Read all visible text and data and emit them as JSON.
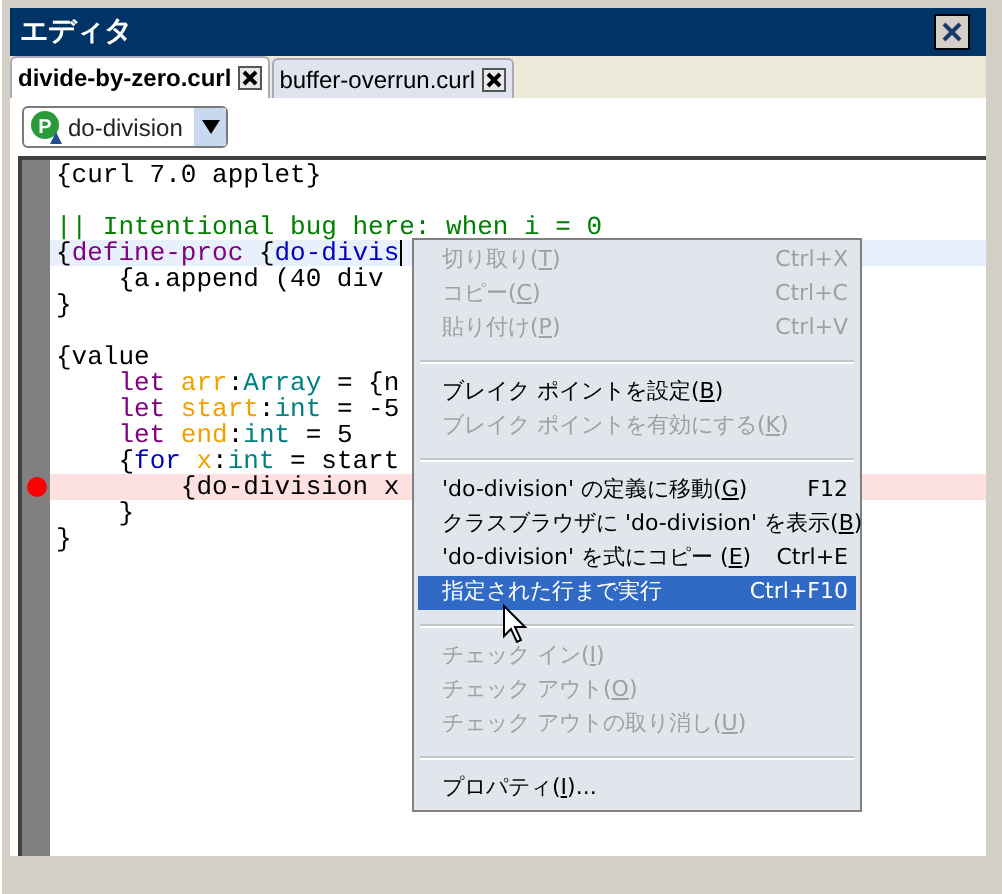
{
  "window": {
    "title": "エディタ"
  },
  "tabs": [
    {
      "label": "divide-by-zero.curl",
      "selected": true
    },
    {
      "label": "buffer-overrun.curl",
      "selected": false
    }
  ],
  "procedure_dropdown": {
    "icon_letter": "P",
    "value": "do-division"
  },
  "code_lines": [
    {
      "current": false,
      "breakpoint": false,
      "segments": [
        {
          "kind": "plain",
          "text": "{curl 7.0 applet}"
        }
      ]
    },
    {
      "current": false,
      "breakpoint": false
    },
    {
      "current": false,
      "breakpoint": false,
      "segments": [
        {
          "kind": "comment",
          "text": "|| Intentional bug here: when i = 0"
        }
      ]
    },
    {
      "current": true,
      "breakpoint": false,
      "segments": [
        {
          "kind": "plain",
          "text": "{"
        },
        {
          "kind": "keyword",
          "text": "define-proc"
        },
        {
          "kind": "plain",
          "text": " {"
        },
        {
          "kind": "name",
          "text": "do-divis"
        }
      ]
    },
    {
      "current": false,
      "breakpoint": false,
      "segments": [
        {
          "kind": "plain",
          "text": "    {a.append (40 div"
        }
      ]
    },
    {
      "current": false,
      "breakpoint": false,
      "segments": [
        {
          "kind": "plain",
          "text": "}"
        }
      ]
    },
    {
      "current": false,
      "breakpoint": false
    },
    {
      "current": false,
      "breakpoint": false,
      "segments": [
        {
          "kind": "plain",
          "text": "{value"
        }
      ]
    },
    {
      "current": false,
      "breakpoint": false,
      "segments": [
        {
          "kind": "keyword",
          "text": "    let"
        },
        {
          "kind": "variable",
          "text": " arr"
        },
        {
          "kind": "plain",
          "text": ":"
        },
        {
          "kind": "type",
          "text": "Array"
        },
        {
          "kind": "plain",
          "text": " = {n"
        }
      ]
    },
    {
      "current": false,
      "breakpoint": false,
      "segments": [
        {
          "kind": "keyword",
          "text": "    let"
        },
        {
          "kind": "variable",
          "text": " start"
        },
        {
          "kind": "plain",
          "text": ":"
        },
        {
          "kind": "type",
          "text": "int"
        },
        {
          "kind": "plain",
          "text": " = -5"
        }
      ]
    },
    {
      "current": false,
      "breakpoint": false,
      "segments": [
        {
          "kind": "keyword",
          "text": "    let"
        },
        {
          "kind": "variable",
          "text": " end"
        },
        {
          "kind": "plain",
          "text": ":"
        },
        {
          "kind": "type",
          "text": "int"
        },
        {
          "kind": "plain",
          "text": " = 5"
        }
      ]
    },
    {
      "current": false,
      "breakpoint": false,
      "segments": [
        {
          "kind": "plain",
          "text": "    {"
        },
        {
          "kind": "name",
          "text": "for"
        },
        {
          "kind": "variable",
          "text": " x"
        },
        {
          "kind": "plain",
          "text": ":"
        },
        {
          "kind": "type",
          "text": "int"
        },
        {
          "kind": "plain",
          "text": " = start"
        }
      ]
    },
    {
      "current": false,
      "breakpoint": true,
      "segments": [
        {
          "kind": "plain",
          "text": "        {do-division x"
        }
      ]
    },
    {
      "current": false,
      "breakpoint": false,
      "segments": [
        {
          "kind": "plain",
          "text": "    }"
        }
      ]
    },
    {
      "current": false,
      "breakpoint": false,
      "segments": [
        {
          "kind": "plain",
          "text": "}"
        }
      ]
    }
  ],
  "context_menu": [
    {
      "kind": "item",
      "label": "切り取り(T)",
      "shortcut": "Ctrl+X",
      "disabled": true,
      "selected": false
    },
    {
      "kind": "item",
      "label": "コピー(C)",
      "shortcut": "Ctrl+C",
      "disabled": true,
      "selected": false
    },
    {
      "kind": "item",
      "label": "貼り付け(P)",
      "shortcut": "Ctrl+V",
      "disabled": true,
      "selected": false
    },
    {
      "kind": "separator"
    },
    {
      "kind": "item",
      "label": "ブレイク ポイントを設定(B)",
      "disabled": false,
      "selected": false
    },
    {
      "kind": "item",
      "label": "ブレイク ポイントを有効にする(K)",
      "disabled": true,
      "selected": false
    },
    {
      "kind": "separator"
    },
    {
      "kind": "item",
      "label": "'do-division' の定義に移動(G)",
      "shortcut": "F12",
      "disabled": false,
      "selected": false
    },
    {
      "kind": "item",
      "label": "クラスブラウザに 'do-division' を表示(B)",
      "disabled": false,
      "selected": false
    },
    {
      "kind": "item",
      "label": "'do-division' を式にコピー (E)",
      "shortcut": "Ctrl+E",
      "disabled": false,
      "selected": false
    },
    {
      "kind": "item",
      "label": "指定された行まで実行",
      "shortcut": "Ctrl+F10",
      "disabled": false,
      "selected": true
    },
    {
      "kind": "separator"
    },
    {
      "kind": "item",
      "label": "チェック イン(I)",
      "disabled": true,
      "selected": false
    },
    {
      "kind": "item",
      "label": "チェック アウト(O)",
      "disabled": true,
      "selected": false
    },
    {
      "kind": "item",
      "label": "チェック アウトの取り消し(U)",
      "disabled": true,
      "selected": false
    },
    {
      "kind": "separator"
    },
    {
      "kind": "item",
      "label": "プロパティ(I)...",
      "disabled": false,
      "selected": false
    }
  ]
}
